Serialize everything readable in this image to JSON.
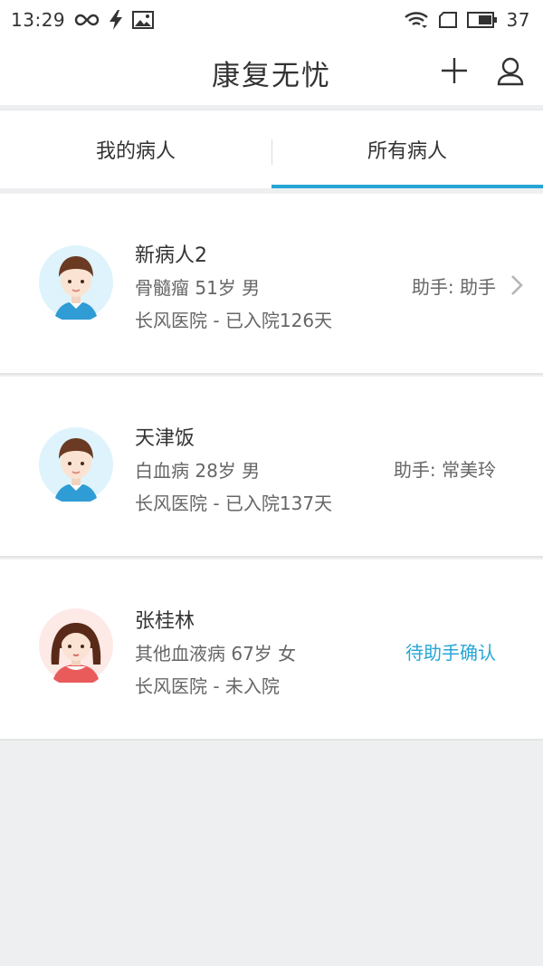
{
  "status_bar": {
    "time": "13:29",
    "battery": "37"
  },
  "app": {
    "title": "康复无忧"
  },
  "tabs": [
    {
      "label": "我的病人"
    },
    {
      "label": "所有病人"
    }
  ],
  "patients": [
    {
      "name": "新病人2",
      "diagnosis_age_sex": "骨髓瘤 51岁 男",
      "hospital_status": "长风医院 - 已入院126天",
      "assistant": "助手: 助手"
    },
    {
      "name": "天津饭",
      "diagnosis_age_sex": "白血病 28岁 男",
      "hospital_status": "长风医院 - 已入院137天",
      "assistant": "助手: 常美玲"
    },
    {
      "name": "张桂林",
      "diagnosis_age_sex": "其他血液病 67岁 女",
      "hospital_status": "长风医院 - 未入院",
      "assistant": "待助手确认"
    }
  ],
  "colors": {
    "accent": "#26a6d6",
    "background": "#eeeff1"
  },
  "icons": {
    "status_left": [
      "infinity-icon",
      "flash-icon",
      "image-icon"
    ],
    "status_right": [
      "wifi-icon",
      "sim-icon",
      "battery-icon"
    ],
    "app_actions": [
      "plus-icon",
      "user-icon"
    ],
    "row_action": "chevron-right-icon"
  }
}
